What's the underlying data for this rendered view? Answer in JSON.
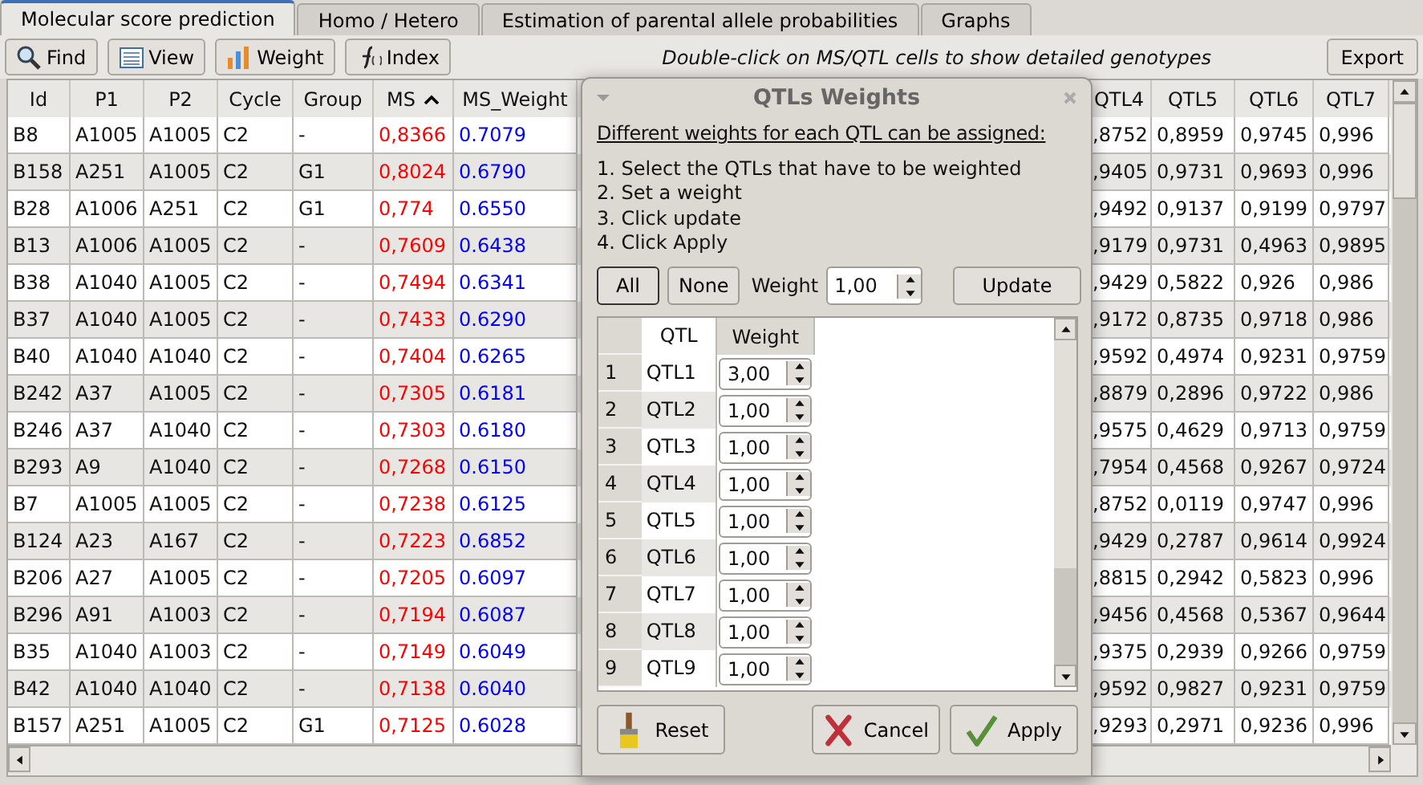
{
  "tabs": [
    {
      "label": "Molecular score prediction",
      "selected": true
    },
    {
      "label": "Homo / Hetero",
      "selected": false
    },
    {
      "label": "Estimation of parental allele probabilities",
      "selected": false
    },
    {
      "label": "Graphs",
      "selected": false
    }
  ],
  "toolbar": {
    "buttons": [
      {
        "label": "Find",
        "kind": "find"
      },
      {
        "label": "View",
        "kind": "view"
      },
      {
        "label": "Weight",
        "kind": "weight"
      },
      {
        "label": "Index",
        "kind": "index"
      }
    ],
    "hint": "Double-click on MS/QTL cells to show detailed genotypes",
    "export": "Export"
  },
  "table": {
    "columns": [
      {
        "label": "Id",
        "kind": "text",
        "sorted": false
      },
      {
        "label": "P1",
        "kind": "text",
        "sorted": false
      },
      {
        "label": "P2",
        "kind": "text",
        "sorted": false
      },
      {
        "label": "Cycle",
        "kind": "text",
        "sorted": false
      },
      {
        "label": "Group",
        "kind": "text",
        "sorted": false
      },
      {
        "label": "MS",
        "kind": "score",
        "sorted": true
      },
      {
        "label": "MS_Weight",
        "kind": "weight",
        "sorted": false
      },
      {
        "label": "QTL4",
        "kind": "text",
        "sorted": false
      },
      {
        "label": "QTL5",
        "kind": "text",
        "sorted": false
      },
      {
        "label": "QTL6",
        "kind": "text",
        "sorted": false
      },
      {
        "label": "QTL7",
        "kind": "text",
        "sorted": false
      }
    ],
    "rows": [
      [
        "B8",
        "A1005",
        "A1005",
        "C2",
        "-",
        "0,8366",
        "0.7079",
        ",8752",
        "0,8959",
        "0,9745",
        "0,996"
      ],
      [
        "B158",
        "A251",
        "A1005",
        "C2",
        "G1",
        "0,8024",
        "0.6790",
        ",9405",
        "0,9731",
        "0,9693",
        "0,996"
      ],
      [
        "B28",
        "A1006",
        "A251",
        "C2",
        "G1",
        "0,774",
        "0.6550",
        ",9492",
        "0,9137",
        "0,9199",
        "0,9797"
      ],
      [
        "B13",
        "A1006",
        "A1005",
        "C2",
        "-",
        "0,7609",
        "0.6438",
        ",9179",
        "0,9731",
        "0,4963",
        "0,9895"
      ],
      [
        "B38",
        "A1040",
        "A1005",
        "C2",
        "-",
        "0,7494",
        "0.6341",
        ",9429",
        "0,5822",
        "0,926",
        "0,986"
      ],
      [
        "B37",
        "A1040",
        "A1005",
        "C2",
        "-",
        "0,7433",
        "0.6290",
        ",9172",
        "0,8735",
        "0,9718",
        "0,986"
      ],
      [
        "B40",
        "A1040",
        "A1040",
        "C2",
        "-",
        "0,7404",
        "0.6265",
        ",9592",
        "0,4974",
        "0,9231",
        "0,9759"
      ],
      [
        "B242",
        "A37",
        "A1005",
        "C2",
        "-",
        "0,7305",
        "0.6181",
        ",8879",
        "0,2896",
        "0,9722",
        "0,986"
      ],
      [
        "B246",
        "A37",
        "A1040",
        "C2",
        "-",
        "0,7303",
        "0.6180",
        ",9575",
        "0,4629",
        "0,9713",
        "0,9759"
      ],
      [
        "B293",
        "A9",
        "A1040",
        "C2",
        "-",
        "0,7268",
        "0.6150",
        ",7954",
        "0,4568",
        "0,9267",
        "0,9724"
      ],
      [
        "B7",
        "A1005",
        "A1005",
        "C2",
        "-",
        "0,7238",
        "0.6125",
        ",8752",
        "0,0119",
        "0,9747",
        "0,996"
      ],
      [
        "B124",
        "A23",
        "A167",
        "C2",
        "-",
        "0,7223",
        "0.6852",
        ",9429",
        "0,2787",
        "0,9614",
        "0,9924"
      ],
      [
        "B206",
        "A27",
        "A1005",
        "C2",
        "-",
        "0,7205",
        "0.6097",
        ",8815",
        "0,2942",
        "0,5823",
        "0,996"
      ],
      [
        "B296",
        "A91",
        "A1003",
        "C2",
        "-",
        "0,7194",
        "0.6087",
        ",9456",
        "0,4568",
        "0,5367",
        "0,9644"
      ],
      [
        "B35",
        "A1040",
        "A1003",
        "C2",
        "-",
        "0,7149",
        "0.6049",
        ",9375",
        "0,2939",
        "0,9266",
        "0,9759"
      ],
      [
        "B42",
        "A1040",
        "A1040",
        "C2",
        "-",
        "0,7138",
        "0.6040",
        ",9592",
        "0,9827",
        "0,9231",
        "0,9759"
      ],
      [
        "B157",
        "A251",
        "A1005",
        "C2",
        "G1",
        "0,7125",
        "0.6028",
        ",9293",
        "0,2971",
        "0,9236",
        "0,996"
      ]
    ]
  },
  "dialog": {
    "title": "QTLs Weights",
    "intro": "Different weights for each QTL can be assigned:",
    "steps": [
      "1. Select the QTLs that have to be weighted",
      "2. Set a weight",
      "3. Click update",
      "4. Click Apply"
    ],
    "select_buttons": [
      {
        "label": "All",
        "selected": true
      },
      {
        "label": "None",
        "selected": false
      }
    ],
    "weight_label": "Weight",
    "weight_value": "1,00",
    "update": "Update",
    "columns": [
      "QTL",
      "Weight"
    ],
    "rows": [
      {
        "index": "1",
        "qtl": "QTL1",
        "weight": "3,00"
      },
      {
        "index": "2",
        "qtl": "QTL2",
        "weight": "1,00"
      },
      {
        "index": "3",
        "qtl": "QTL3",
        "weight": "1,00"
      },
      {
        "index": "4",
        "qtl": "QTL4",
        "weight": "1,00"
      },
      {
        "index": "5",
        "qtl": "QTL5",
        "weight": "1,00"
      },
      {
        "index": "6",
        "qtl": "QTL6",
        "weight": "1,00"
      },
      {
        "index": "7",
        "qtl": "QTL7",
        "weight": "1,00"
      },
      {
        "index": "8",
        "qtl": "QTL8",
        "weight": "1,00"
      },
      {
        "index": "9",
        "qtl": "QTL9",
        "weight": "1,00"
      }
    ],
    "buttons": [
      {
        "label": "Reset",
        "kind": "reset"
      },
      {
        "label": "Cancel",
        "kind": "cancel"
      },
      {
        "label": "Apply",
        "kind": "apply"
      }
    ]
  }
}
